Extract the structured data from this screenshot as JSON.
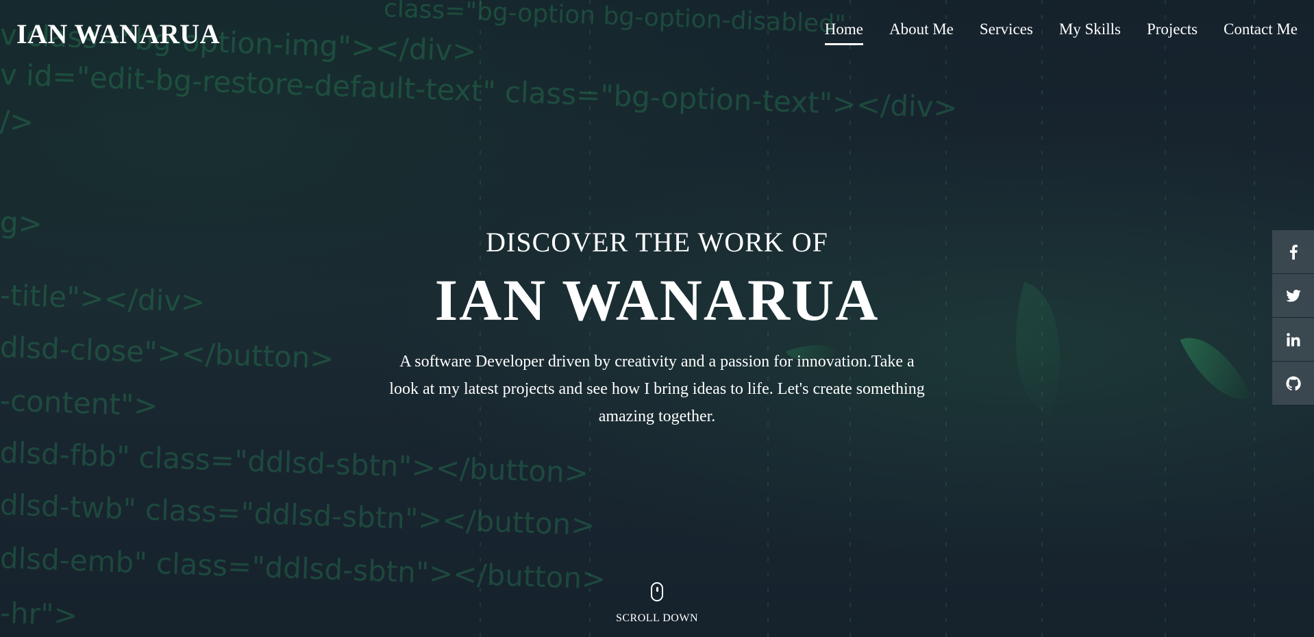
{
  "header": {
    "logo": "IAN WANARUA",
    "nav": [
      {
        "label": "Home",
        "active": true
      },
      {
        "label": "About Me",
        "active": false
      },
      {
        "label": "Services",
        "active": false
      },
      {
        "label": "My Skills",
        "active": false
      },
      {
        "label": "Projects",
        "active": false
      },
      {
        "label": "Contact Me",
        "active": false
      }
    ]
  },
  "hero": {
    "eyebrow": "DISCOVER THE WORK OF",
    "headline": "IAN WANARUA",
    "tagline": "A software Developer driven by creativity and a passion for innovation.Take a look at my latest projects and see how I bring ideas to life. Let's create something amazing together."
  },
  "background_code": [
    "class=\"bg-option bg-option-disabled\"",
    "v class=\"bg-option-img\"></div>",
    "v id=\"edit-bg-restore-default-text\" class=\"bg-option-text\"></div>",
    "/>",
    "g>",
    "-title\"></div>",
    "dlsd-close\"></button>",
    "-content\">",
    "dlsd-fbb\" class=\"ddlsd-sbtn\"></button>",
    "dlsd-twb\" class=\"ddlsd-sbtn\"></button>",
    "dlsd-emb\" class=\"ddlsd-sbtn\"></button>",
    "-hr\">"
  ],
  "scroll": {
    "label": "SCROLL DOWN",
    "icon": "mouse-icon"
  },
  "social": [
    {
      "name": "facebook-icon"
    },
    {
      "name": "twitter-icon"
    },
    {
      "name": "linkedin-icon"
    },
    {
      "name": "github-icon"
    }
  ],
  "colors": {
    "background": "#17212b",
    "code_green": "#2fa866",
    "text": "#ffffff",
    "social_bg": "#46505a"
  }
}
